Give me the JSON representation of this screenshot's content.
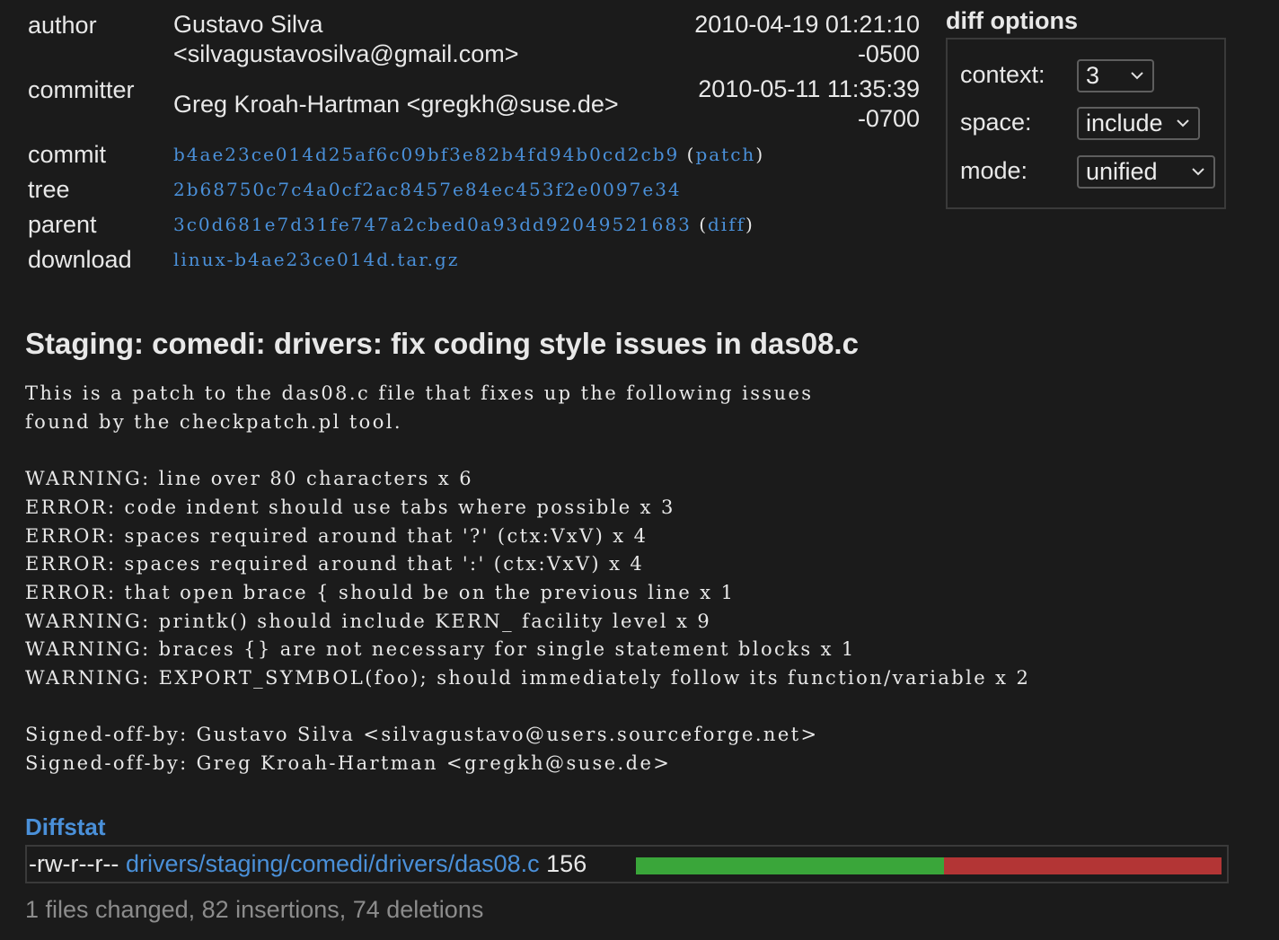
{
  "commit_info": {
    "author_label": "author",
    "author_name": "Gustavo Silva",
    "author_email": "<silvagustavosilva@gmail.com>",
    "author_date": "2010-04-19 01:21:10",
    "author_tz": "-0500",
    "committer_label": "committer",
    "committer": "Greg Kroah-Hartman <gregkh@suse.de>",
    "committer_date": "2010-05-11 11:35:39",
    "committer_tz": "-0700",
    "commit_label": "commit",
    "commit_hash": "b4ae23ce014d25af6c09bf3e82b4fd94b0cd2cb9",
    "patch_link": "patch",
    "tree_label": "tree",
    "tree_hash": "2b68750c7c4a0cf2ac8457e84ec453f2e0097e34",
    "parent_label": "parent",
    "parent_hash": "3c0d681e7d31fe747a2cbed0a93dd92049521683",
    "diff_link": "diff",
    "download_label": "download",
    "download_file": "linux-b4ae23ce014d.tar.gz",
    "paren_open": "(",
    "paren_close": ")"
  },
  "diff_options": {
    "title": "diff options",
    "context_label": "context:",
    "context_value": "3",
    "space_label": "space:",
    "space_value": "include",
    "mode_label": "mode:",
    "mode_value": "unified"
  },
  "message": {
    "subject": "Staging: comedi: drivers: fix coding style issues in das08.c",
    "body": "This is a patch to the das08.c file that fixes up the following issues\nfound by the checkpatch.pl tool.\n\nWARNING: line over 80 characters x 6\nERROR: code indent should use tabs where possible x 3\nERROR: spaces required around that '?' (ctx:VxV) x 4\nERROR: spaces required around that ':' (ctx:VxV) x 4\nERROR: that open brace { should be on the previous line x 1\nWARNING: printk() should include KERN_ facility level x 9\nWARNING: braces {} are not necessary for single statement blocks x 1\nWARNING: EXPORT_SYMBOL(foo); should immediately follow its function/variable x 2\n\nSigned-off-by: Gustavo Silva <silvagustavo@users.sourceforge.net>\nSigned-off-by: Greg Kroah-Hartman <gregkh@suse.de>"
  },
  "diffstat": {
    "title": "Diffstat",
    "mode": "-rw-r--r--",
    "file": "drivers/staging/comedi/drivers/das08.c",
    "changes": "156",
    "insertions": 82,
    "deletions": 74,
    "summary": "1 files changed, 82 insertions, 74 deletions",
    "colors": {
      "insert": "#3aa63a",
      "delete": "#b33535"
    }
  }
}
